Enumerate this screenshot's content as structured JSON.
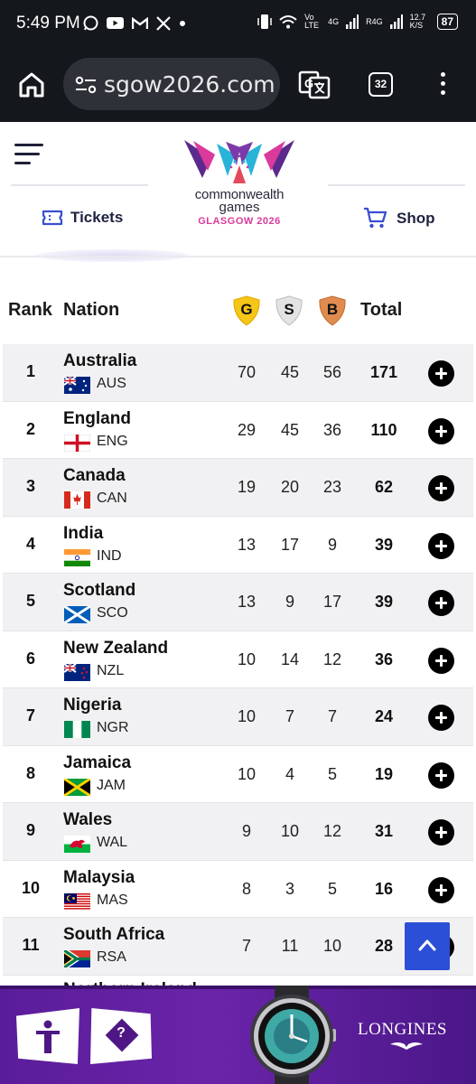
{
  "status_bar": {
    "time": "5:49 PM",
    "network_1": "Vo LTE",
    "network_2": "4G",
    "network_3": "R4G",
    "speed": "12.7 K/S",
    "battery": "87"
  },
  "browser": {
    "url": "sgow2026.com",
    "tab_count": "32"
  },
  "header": {
    "logo_line1": "commonwealth",
    "logo_line2": "games",
    "logo_line3": "GLASGOW 2026",
    "tickets_label": "Tickets",
    "shop_label": "Shop"
  },
  "table": {
    "headers": {
      "rank": "Rank",
      "nation": "Nation",
      "gold": "G",
      "silver": "S",
      "bronze": "B",
      "total": "Total"
    },
    "rows": [
      {
        "rank": "1",
        "nation": "Australia",
        "code": "AUS",
        "gold": "70",
        "silver": "45",
        "bronze": "56",
        "total": "171"
      },
      {
        "rank": "2",
        "nation": "England",
        "code": "ENG",
        "gold": "29",
        "silver": "45",
        "bronze": "36",
        "total": "110"
      },
      {
        "rank": "3",
        "nation": "Canada",
        "code": "CAN",
        "gold": "19",
        "silver": "20",
        "bronze": "23",
        "total": "62"
      },
      {
        "rank": "4",
        "nation": "India",
        "code": "IND",
        "gold": "13",
        "silver": "17",
        "bronze": "9",
        "total": "39"
      },
      {
        "rank": "5",
        "nation": "Scotland",
        "code": "SCO",
        "gold": "13",
        "silver": "9",
        "bronze": "17",
        "total": "39"
      },
      {
        "rank": "6",
        "nation": "New Zealand",
        "code": "NZL",
        "gold": "10",
        "silver": "14",
        "bronze": "12",
        "total": "36"
      },
      {
        "rank": "7",
        "nation": "Nigeria",
        "code": "NGR",
        "gold": "10",
        "silver": "7",
        "bronze": "7",
        "total": "24"
      },
      {
        "rank": "8",
        "nation": "Jamaica",
        "code": "JAM",
        "gold": "10",
        "silver": "4",
        "bronze": "5",
        "total": "19"
      },
      {
        "rank": "9",
        "nation": "Wales",
        "code": "WAL",
        "gold": "9",
        "silver": "10",
        "bronze": "12",
        "total": "31"
      },
      {
        "rank": "10",
        "nation": "Malaysia",
        "code": "MAS",
        "gold": "8",
        "silver": "3",
        "bronze": "5",
        "total": "16"
      },
      {
        "rank": "11",
        "nation": "South Africa",
        "code": "RSA",
        "gold": "7",
        "silver": "11",
        "bronze": "10",
        "total": "28"
      }
    ],
    "partial_row_nation": "Northern Ireland"
  },
  "ad": {
    "brand": "LONGINES",
    "help_symbol": "?"
  },
  "colors": {
    "gold": "#f5c518",
    "silver": "#d9d9d9",
    "bronze": "#d9834a",
    "accent_blue": "#2c4fd8",
    "ad_purple": "#5a1d9a"
  }
}
